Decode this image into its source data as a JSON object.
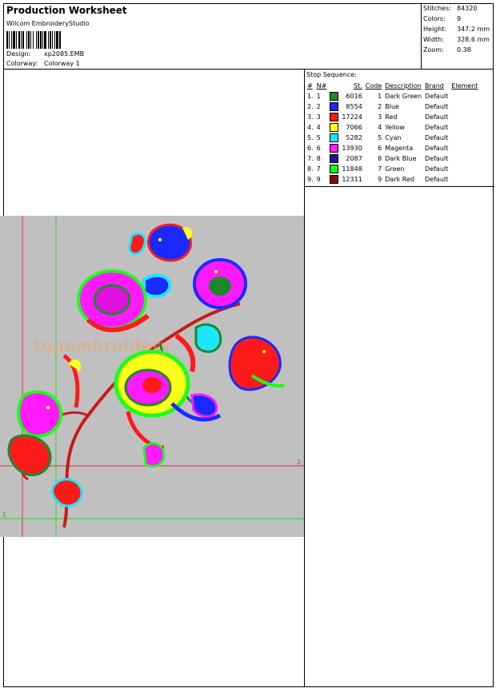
{
  "header": {
    "title": "Production Worksheet",
    "software": "Wilcom EmbroideryStudio",
    "design_label": "Design:",
    "design_value": "xp2085.EMB",
    "colorway_label": "Colorway:",
    "colorway_value": "Colorway 1"
  },
  "stats": [
    {
      "label": "Stitches:",
      "value": "84320"
    },
    {
      "label": "Colors:",
      "value": "9"
    },
    {
      "label": "Height:",
      "value": "347.2 mm"
    },
    {
      "label": "Width:",
      "value": "328.6 mm"
    },
    {
      "label": "Zoom:",
      "value": "0.38"
    }
  ],
  "stop_sequence": {
    "title": "Stop Sequence:",
    "columns": [
      "#",
      "N#",
      "St.",
      "Code",
      "Description",
      "Brand",
      "Element"
    ],
    "rows": [
      {
        "n": "1.",
        "nn": "1",
        "color": "#1a8a2a",
        "st": "6016",
        "code": "1",
        "desc": "Dark Green",
        "brand": "Default"
      },
      {
        "n": "2.",
        "nn": "2",
        "color": "#1a2aff",
        "st": "8554",
        "code": "2",
        "desc": "Blue",
        "brand": "Default"
      },
      {
        "n": "3.",
        "nn": "3",
        "color": "#ff1a1a",
        "st": "17224",
        "code": "3",
        "desc": "Red",
        "brand": "Default"
      },
      {
        "n": "4.",
        "nn": "4",
        "color": "#ffff1a",
        "st": "7066",
        "code": "4",
        "desc": "Yellow",
        "brand": "Default"
      },
      {
        "n": "5.",
        "nn": "5",
        "color": "#1ae6ff",
        "st": "5282",
        "code": "5",
        "desc": "Cyan",
        "brand": "Default"
      },
      {
        "n": "6.",
        "nn": "6",
        "color": "#ff1aff",
        "st": "13930",
        "code": "6",
        "desc": "Magenta",
        "brand": "Default"
      },
      {
        "n": "7.",
        "nn": "8",
        "color": "#1a1a9a",
        "st": "2087",
        "code": "8",
        "desc": "Dark Blue",
        "brand": "Default"
      },
      {
        "n": "8.",
        "nn": "7",
        "color": "#1aff1a",
        "st": "11848",
        "code": "7",
        "desc": "Green",
        "brand": "Default"
      },
      {
        "n": "9.",
        "nn": "9",
        "color": "#8a0a0a",
        "st": "12311",
        "code": "9",
        "desc": "Dark Red",
        "brand": "Default"
      }
    ]
  },
  "canvas": {
    "background": "#c0c0c0",
    "watermark": "topembroidery",
    "guide_h_label": "2",
    "guide_v_label": "1"
  }
}
